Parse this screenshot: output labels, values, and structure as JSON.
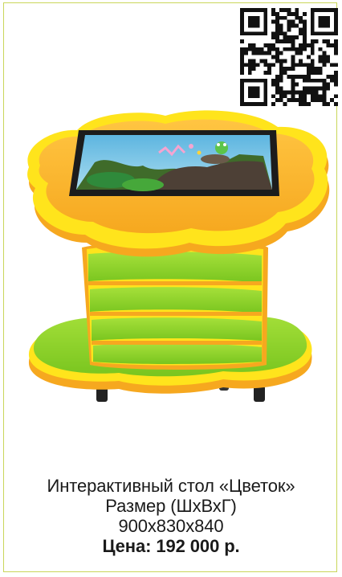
{
  "product": {
    "title": "Интерактивный стол «Цветок»",
    "size_label": "Размер (ШхВхГ)",
    "dimensions": "900х830х840",
    "price": "Цена: 192 000 р."
  },
  "colors": {
    "frame": "#c9d65a",
    "table_top": "#f9b62e",
    "yellow": "#ffe41c",
    "green": "#8cd32c",
    "screen_bezel": "#1c1c1c"
  }
}
